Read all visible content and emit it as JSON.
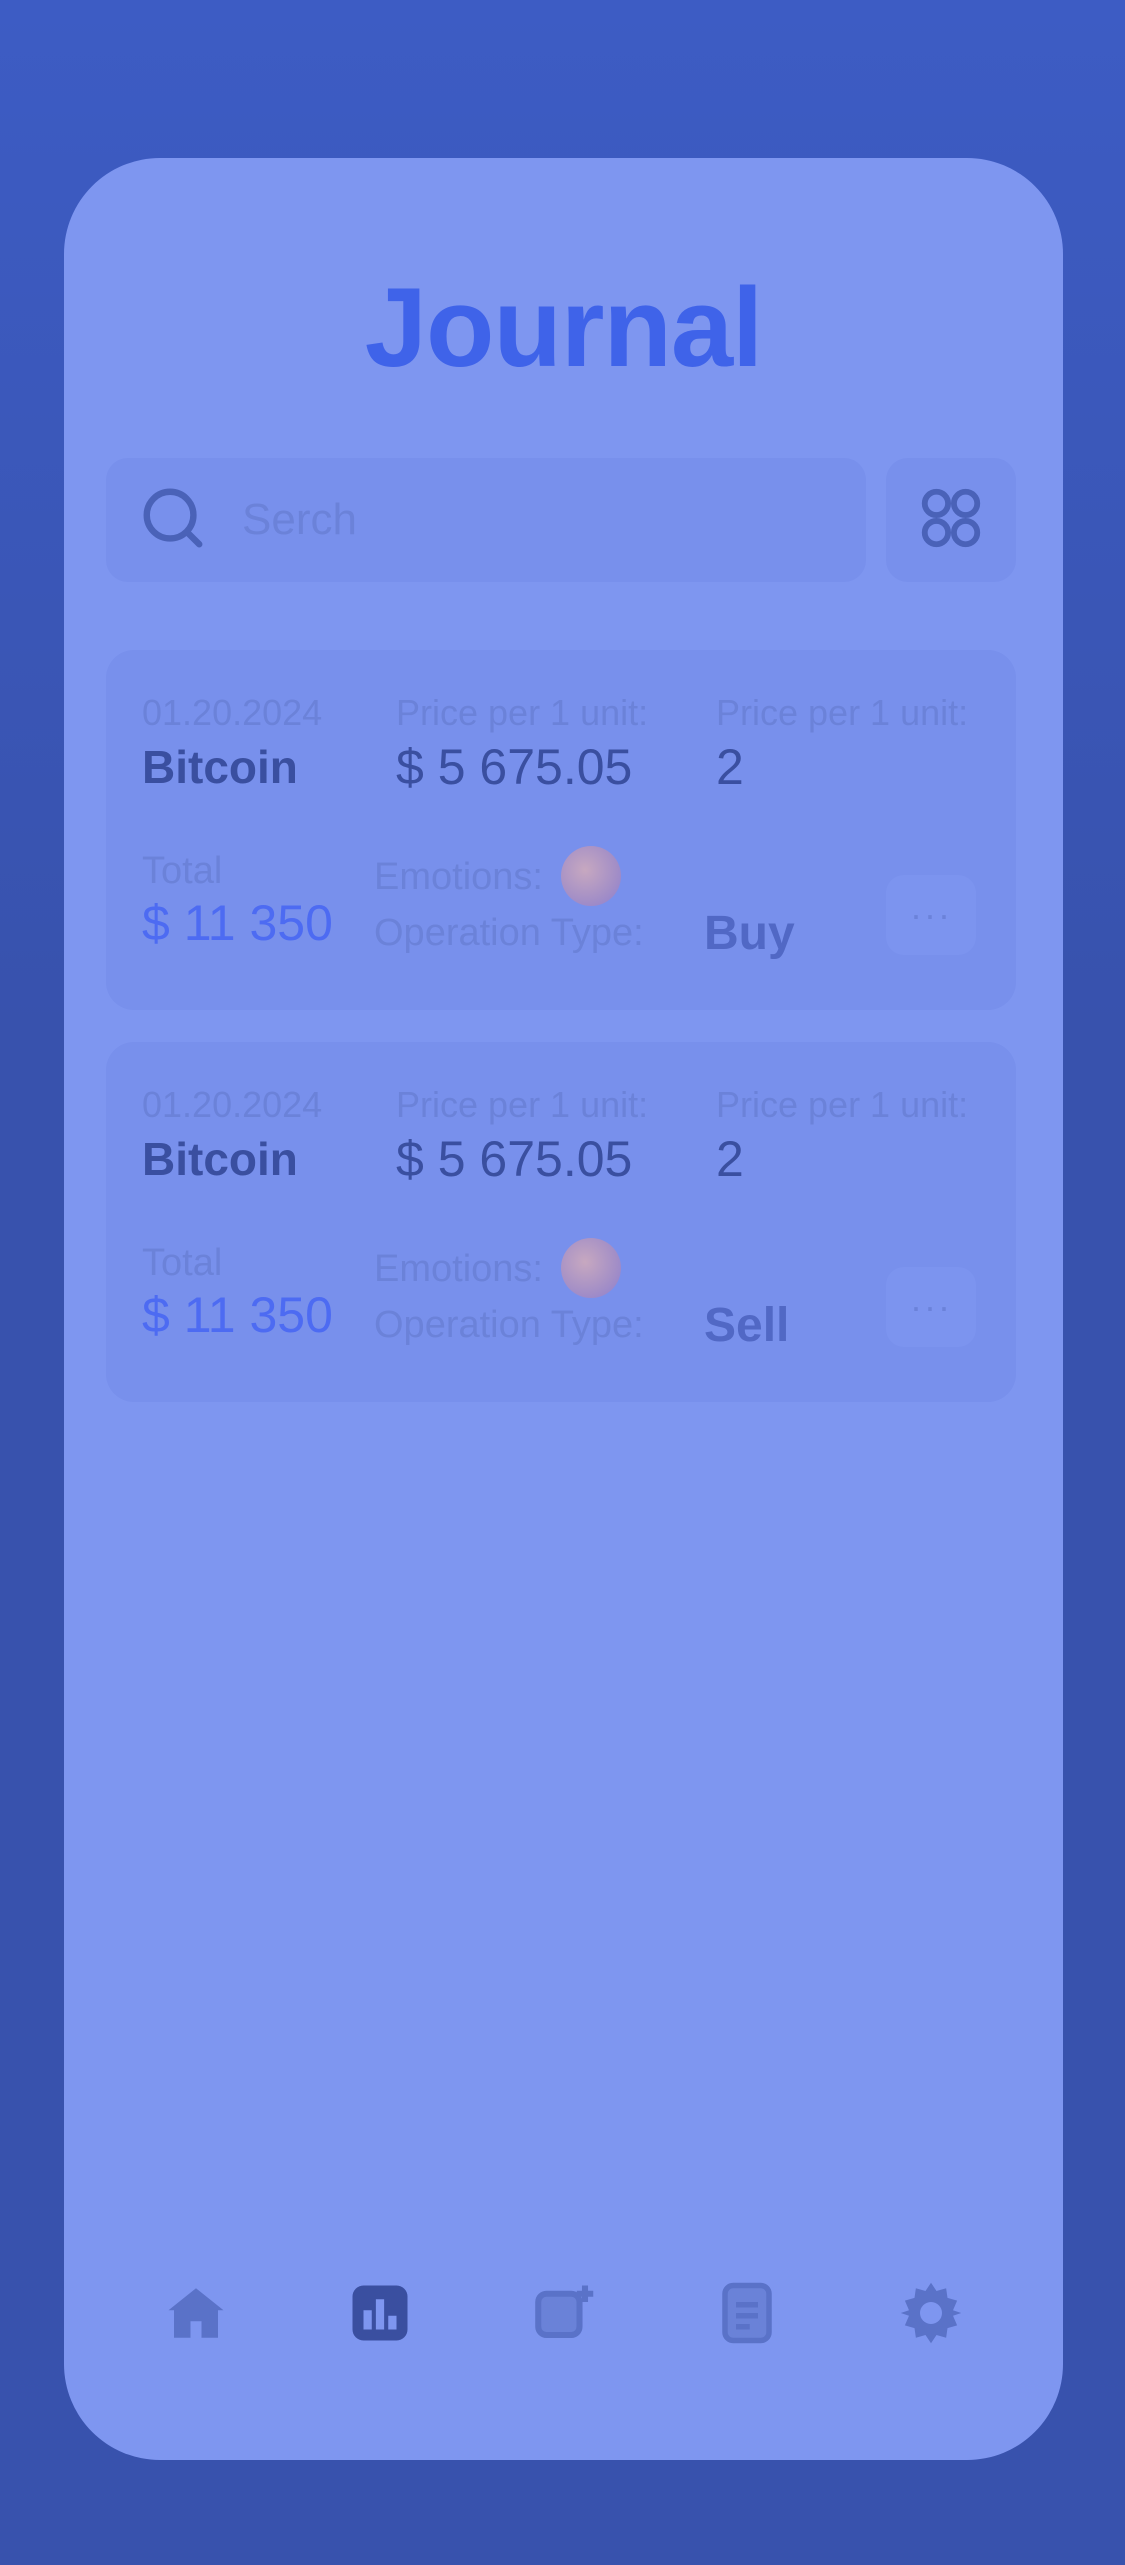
{
  "page": {
    "title": "Journal"
  },
  "search": {
    "placeholder": "Serch",
    "icon": "search-icon"
  },
  "grid_button": {
    "icon": "grid-icon"
  },
  "entries": [
    {
      "date": "01.20.2024",
      "asset": "Bitcoin",
      "price_label": "Price per 1 unit:",
      "price": "$ 5 675.05",
      "quantity_label": "Price per 1 unit:",
      "quantity": "2",
      "total_label": "Total",
      "total": "$ 11 350",
      "emotions_label": "Emotions:",
      "emotion_icon": "emoji-icon",
      "operation_label": "Operation Type:",
      "operation_type": "Buy",
      "more_label": "···"
    },
    {
      "date": "01.20.2024",
      "asset": "Bitcoin",
      "price_label": "Price per 1 unit:",
      "price": "$ 5 675.05",
      "quantity_label": "Price per 1 unit:",
      "quantity": "2",
      "total_label": "Total",
      "total": "$ 11 350",
      "emotions_label": "Emotions:",
      "emotion_icon": "emoji-icon",
      "operation_label": "Operation Type:",
      "operation_type": "Sell",
      "more_label": "···"
    }
  ],
  "nav": [
    {
      "icon": "home-icon",
      "active": false
    },
    {
      "icon": "chart-icon",
      "active": true
    },
    {
      "icon": "add-note-icon",
      "active": false
    },
    {
      "icon": "document-icon",
      "active": false
    },
    {
      "icon": "settings-icon",
      "active": false
    }
  ],
  "colors": {
    "background": "#3852ad",
    "panel": "#7e96f0",
    "accent": "#3f63e9",
    "total": "#4d6bf2"
  }
}
